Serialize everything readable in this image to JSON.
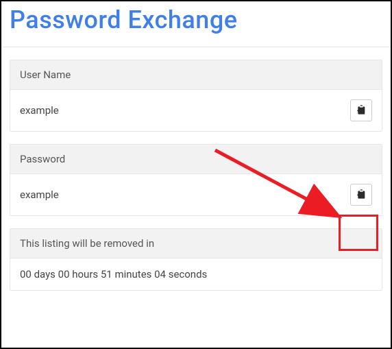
{
  "title": "Password Exchange",
  "username": {
    "label": "User Name",
    "value": "example"
  },
  "password": {
    "label": "Password",
    "value": "example"
  },
  "countdown": {
    "label": "This listing will be removed in",
    "value": "00 days 00 hours 51 minutes 04 seconds"
  },
  "annotation": {
    "highlight_color": "#ec1c24"
  }
}
